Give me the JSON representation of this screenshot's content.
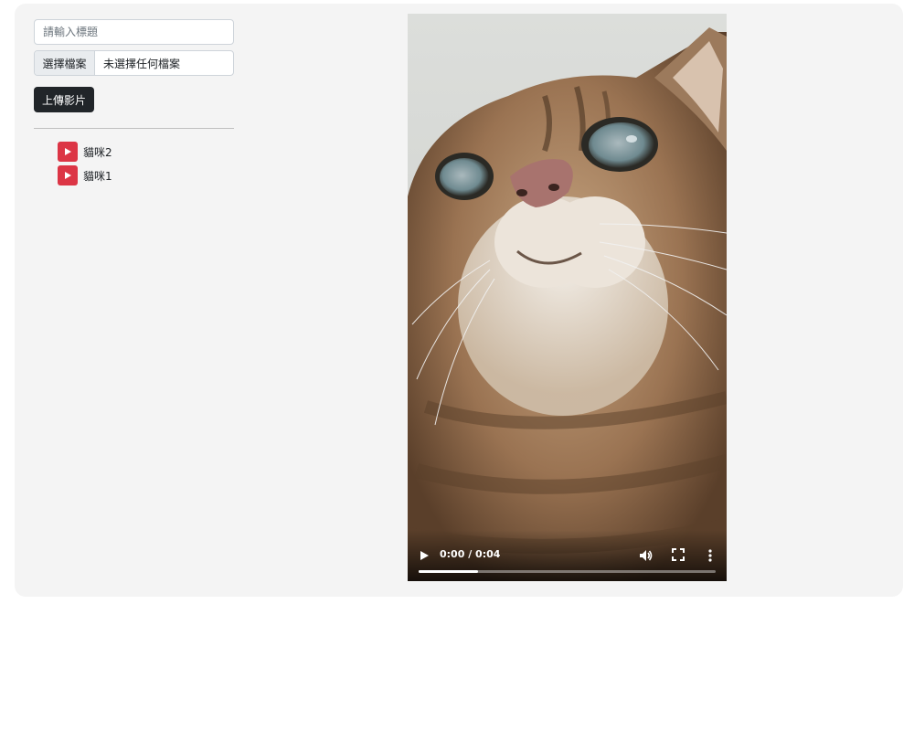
{
  "form": {
    "title_placeholder": "請輸入標題",
    "title_value": "",
    "file_button_label": "選擇檔案",
    "file_status": "未選擇任何檔案",
    "upload_button_label": "上傳影片"
  },
  "videos": [
    {
      "title": "貓咪2"
    },
    {
      "title": "貓咪1"
    }
  ],
  "player": {
    "time_display": "0:00 / 0:04",
    "progress_fraction": 0.2,
    "play_icon": "play-icon",
    "volume_icon": "volume-icon",
    "fullscreen_icon": "fullscreen-icon",
    "more_icon": "more-vertical-icon"
  },
  "colors": {
    "panel_bg": "#f4f4f4",
    "upload_button": "#212529",
    "play_badge": "#dc3545"
  }
}
